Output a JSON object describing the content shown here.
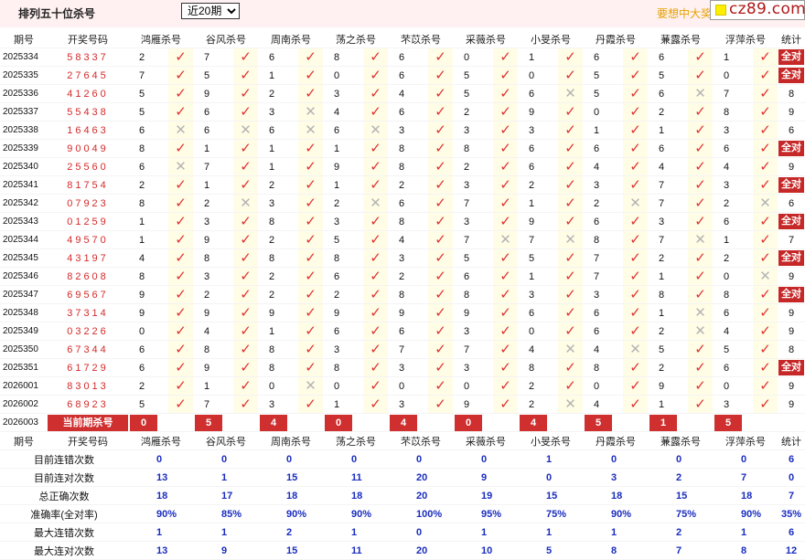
{
  "header": {
    "title": "排列五十位杀号",
    "period_select": "近20期",
    "tagline": "要想中大奖",
    "logo": "cz89.com"
  },
  "table": {
    "columns": [
      "期号",
      "开奖号码",
      "鸿雁杀号",
      "谷风杀号",
      "周南杀号",
      "荡之杀号",
      "芣苡杀号",
      "采薇杀号",
      "小旻杀号",
      "丹霞杀号",
      "蒹露杀号",
      "浮萍杀号",
      "统计"
    ],
    "rows": [
      {
        "period": "2025334",
        "result": "58337",
        "kills": [
          "2",
          "7",
          "6",
          "8",
          "6",
          "0",
          "1",
          "6",
          "6",
          "1"
        ],
        "hits": [
          1,
          1,
          1,
          1,
          1,
          1,
          1,
          1,
          1,
          1
        ],
        "tongji": "全对"
      },
      {
        "period": "2025335",
        "result": "27645",
        "kills": [
          "7",
          "5",
          "1",
          "0",
          "6",
          "5",
          "0",
          "5",
          "5",
          "0"
        ],
        "hits": [
          1,
          1,
          1,
          1,
          1,
          1,
          1,
          1,
          1,
          1
        ],
        "tongji": "全对"
      },
      {
        "period": "2025336",
        "result": "41260",
        "kills": [
          "5",
          "9",
          "2",
          "3",
          "4",
          "5",
          "6",
          "5",
          "6",
          "7"
        ],
        "hits": [
          1,
          1,
          1,
          1,
          1,
          1,
          0,
          1,
          0,
          1
        ],
        "tongji": "8"
      },
      {
        "period": "2025337",
        "result": "55438",
        "kills": [
          "5",
          "6",
          "3",
          "4",
          "6",
          "2",
          "9",
          "0",
          "2",
          "8"
        ],
        "hits": [
          1,
          1,
          0,
          1,
          1,
          1,
          1,
          1,
          1,
          1
        ],
        "tongji": "9"
      },
      {
        "period": "2025338",
        "result": "16463",
        "kills": [
          "6",
          "6",
          "6",
          "6",
          "3",
          "3",
          "3",
          "1",
          "1",
          "3"
        ],
        "hits": [
          0,
          0,
          0,
          0,
          1,
          1,
          1,
          1,
          1,
          1
        ],
        "tongji": "6"
      },
      {
        "period": "2025339",
        "result": "90049",
        "kills": [
          "8",
          "1",
          "1",
          "1",
          "8",
          "8",
          "6",
          "6",
          "6",
          "6"
        ],
        "hits": [
          1,
          1,
          1,
          1,
          1,
          1,
          1,
          1,
          1,
          1
        ],
        "tongji": "全对"
      },
      {
        "period": "2025340",
        "result": "25560",
        "kills": [
          "6",
          "7",
          "1",
          "9",
          "8",
          "2",
          "6",
          "4",
          "4",
          "4"
        ],
        "hits": [
          0,
          1,
          1,
          1,
          1,
          1,
          1,
          1,
          1,
          1
        ],
        "tongji": "9"
      },
      {
        "period": "2025341",
        "result": "81754",
        "kills": [
          "2",
          "1",
          "2",
          "1",
          "2",
          "3",
          "2",
          "3",
          "7",
          "3"
        ],
        "hits": [
          1,
          1,
          1,
          1,
          1,
          1,
          1,
          1,
          1,
          1
        ],
        "tongji": "全对"
      },
      {
        "period": "2025342",
        "result": "07923",
        "kills": [
          "8",
          "2",
          "3",
          "2",
          "6",
          "7",
          "1",
          "2",
          "7",
          "2"
        ],
        "hits": [
          1,
          0,
          1,
          0,
          1,
          1,
          1,
          0,
          1,
          0
        ],
        "tongji": "6"
      },
      {
        "period": "2025343",
        "result": "01259",
        "kills": [
          "1",
          "3",
          "8",
          "3",
          "8",
          "3",
          "9",
          "6",
          "3",
          "6"
        ],
        "hits": [
          1,
          1,
          1,
          1,
          1,
          1,
          1,
          1,
          1,
          1
        ],
        "tongji": "全对"
      },
      {
        "period": "2025344",
        "result": "49570",
        "kills": [
          "1",
          "9",
          "2",
          "5",
          "4",
          "7",
          "7",
          "8",
          "7",
          "1"
        ],
        "hits": [
          1,
          1,
          1,
          1,
          1,
          0,
          0,
          1,
          0,
          1
        ],
        "tongji": "7"
      },
      {
        "period": "2025345",
        "result": "43197",
        "kills": [
          "4",
          "8",
          "8",
          "8",
          "3",
          "5",
          "5",
          "7",
          "2",
          "2"
        ],
        "hits": [
          1,
          1,
          1,
          1,
          1,
          1,
          1,
          1,
          1,
          1
        ],
        "tongji": "全对"
      },
      {
        "period": "2025346",
        "result": "82608",
        "kills": [
          "8",
          "3",
          "2",
          "6",
          "2",
          "6",
          "1",
          "7",
          "1",
          "0"
        ],
        "hits": [
          1,
          1,
          1,
          1,
          1,
          1,
          1,
          1,
          1,
          0
        ],
        "tongji": "9"
      },
      {
        "period": "2025347",
        "result": "69567",
        "kills": [
          "9",
          "2",
          "2",
          "2",
          "8",
          "8",
          "3",
          "3",
          "8",
          "8"
        ],
        "hits": [
          1,
          1,
          1,
          1,
          1,
          1,
          1,
          1,
          1,
          1
        ],
        "tongji": "全对"
      },
      {
        "period": "2025348",
        "result": "37314",
        "kills": [
          "9",
          "9",
          "9",
          "9",
          "9",
          "9",
          "6",
          "6",
          "1",
          "6"
        ],
        "hits": [
          1,
          1,
          1,
          1,
          1,
          1,
          1,
          1,
          0,
          1
        ],
        "tongji": "9"
      },
      {
        "period": "2025349",
        "result": "03226",
        "kills": [
          "0",
          "4",
          "1",
          "6",
          "6",
          "3",
          "0",
          "6",
          "2",
          "4"
        ],
        "hits": [
          1,
          1,
          1,
          1,
          1,
          1,
          1,
          1,
          0,
          1
        ],
        "tongji": "9"
      },
      {
        "period": "2025350",
        "result": "67344",
        "kills": [
          "6",
          "8",
          "8",
          "3",
          "7",
          "7",
          "4",
          "4",
          "5",
          "5"
        ],
        "hits": [
          1,
          1,
          1,
          1,
          1,
          1,
          0,
          0,
          1,
          1
        ],
        "tongji": "8"
      },
      {
        "period": "2025351",
        "result": "61729",
        "kills": [
          "6",
          "9",
          "8",
          "8",
          "3",
          "3",
          "8",
          "8",
          "2",
          "6"
        ],
        "hits": [
          1,
          1,
          1,
          1,
          1,
          1,
          1,
          1,
          1,
          1
        ],
        "tongji": "全对"
      },
      {
        "period": "2026001",
        "result": "83013",
        "kills": [
          "2",
          "1",
          "0",
          "0",
          "0",
          "0",
          "2",
          "0",
          "9",
          "0"
        ],
        "hits": [
          1,
          1,
          0,
          1,
          1,
          1,
          1,
          1,
          1,
          1
        ],
        "tongji": "9"
      },
      {
        "period": "2026002",
        "result": "68923",
        "kills": [
          "5",
          "7",
          "3",
          "1",
          "3",
          "9",
          "2",
          "4",
          "1",
          "3"
        ],
        "hits": [
          1,
          1,
          1,
          1,
          1,
          1,
          0,
          1,
          1,
          1
        ],
        "tongji": "9"
      }
    ],
    "current": {
      "period": "2026003",
      "label": "当前期杀号",
      "kills": [
        "0",
        "5",
        "4",
        "0",
        "4",
        "0",
        "4",
        "5",
        "1",
        "5"
      ]
    }
  },
  "stats": {
    "rows": [
      {
        "label": "目前连错次数",
        "values": [
          "0",
          "0",
          "0",
          "0",
          "0",
          "0",
          "1",
          "0",
          "0",
          "0"
        ],
        "tongji": "6"
      },
      {
        "label": "目前连对次数",
        "values": [
          "13",
          "1",
          "15",
          "11",
          "20",
          "9",
          "0",
          "3",
          "2",
          "7"
        ],
        "tongji": "0"
      },
      {
        "label": "总正确次数",
        "values": [
          "18",
          "17",
          "18",
          "18",
          "20",
          "19",
          "15",
          "18",
          "15",
          "18"
        ],
        "tongji": "7"
      },
      {
        "label": "准确率(全对率)",
        "values": [
          "90%",
          "85%",
          "90%",
          "90%",
          "100%",
          "95%",
          "75%",
          "90%",
          "75%",
          "90%"
        ],
        "tongji": "35%"
      },
      {
        "label": "最大连错次数",
        "values": [
          "1",
          "1",
          "2",
          "1",
          "0",
          "1",
          "1",
          "1",
          "2",
          "1"
        ],
        "tongji": "6"
      },
      {
        "label": "最大连对次数",
        "values": [
          "13",
          "9",
          "15",
          "11",
          "20",
          "10",
          "5",
          "8",
          "7",
          "8"
        ],
        "tongji": "12"
      }
    ]
  },
  "colors": {
    "hit": "#e03131",
    "miss": "#b4b4b4",
    "badge": "#c62828",
    "stat_value": "#1a2dbf",
    "stat_rate": "#e11b1b",
    "mark_bg": "#fffde6"
  },
  "icons": {
    "hit": "check-icon",
    "miss": "cross-icon"
  }
}
